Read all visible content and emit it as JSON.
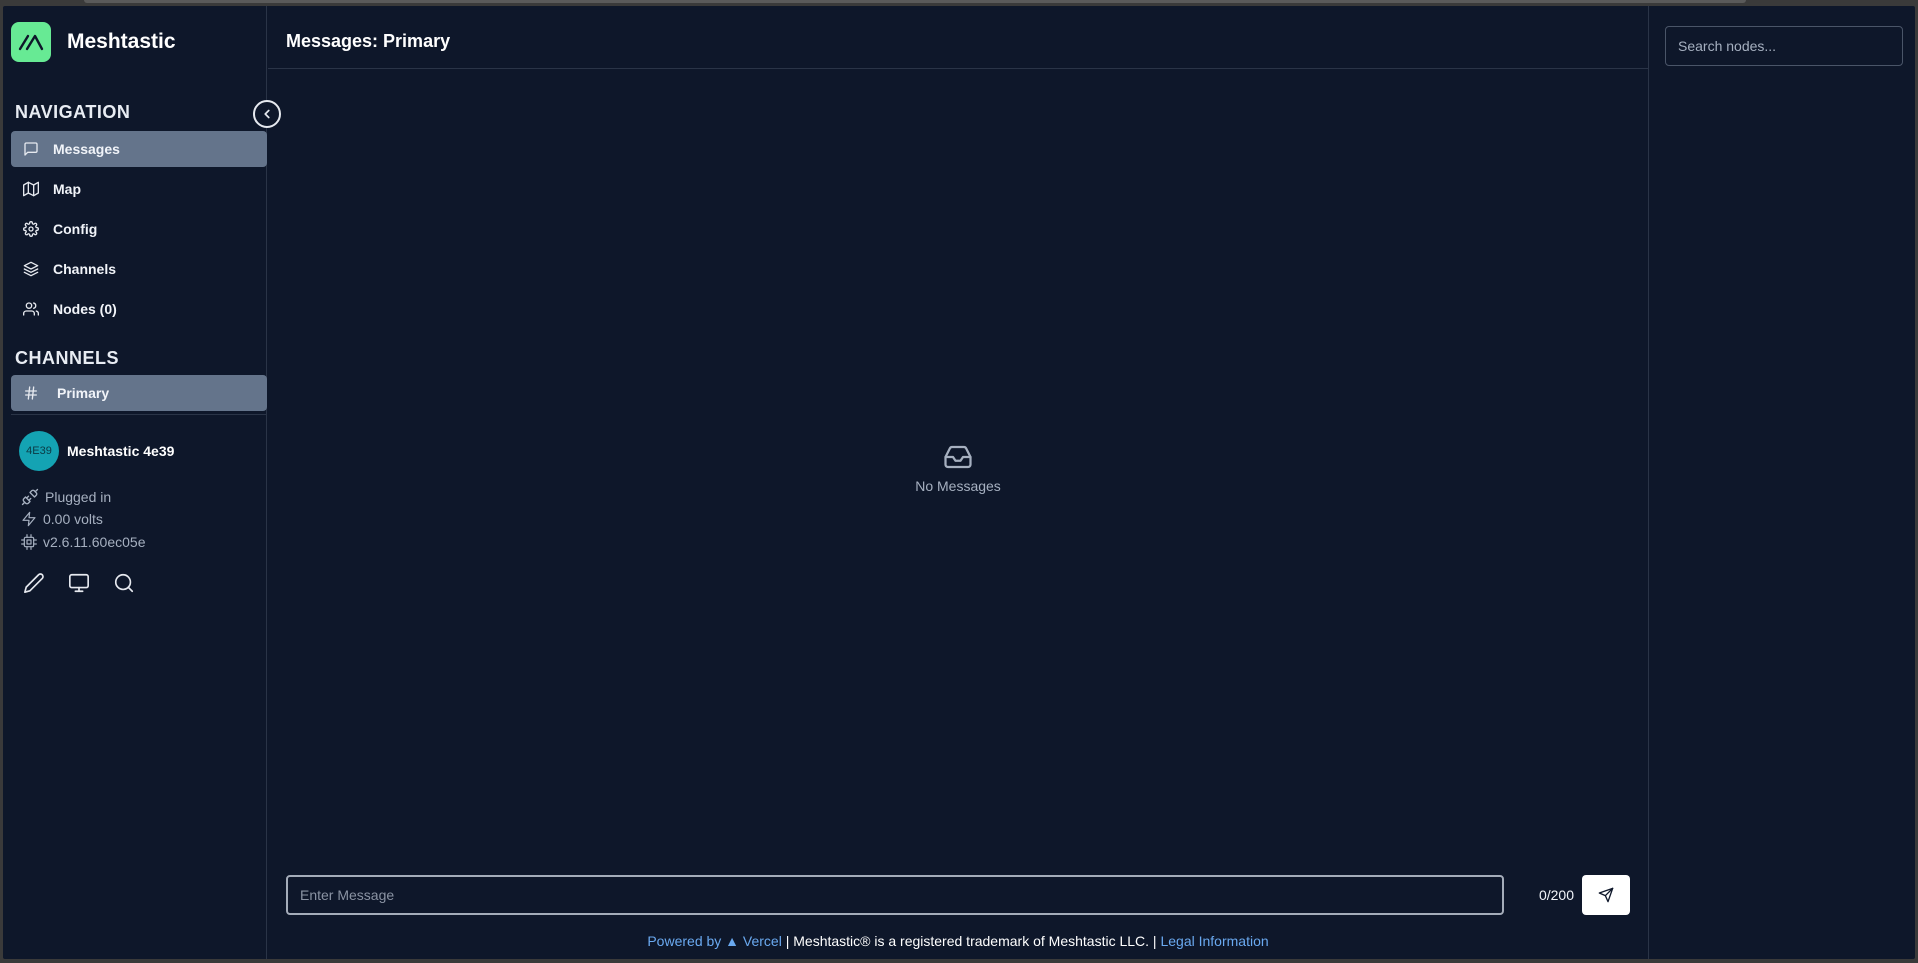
{
  "app": {
    "name": "Meshtastic",
    "accent": "#67ea94",
    "background": "#0e172a",
    "active_item_bg": "#64748b"
  },
  "sidebar": {
    "navigation_title": "NAVIGATION",
    "nav_items": [
      {
        "label": "Messages",
        "icon": "message-square-icon",
        "active": true
      },
      {
        "label": "Map",
        "icon": "map-icon",
        "active": false
      },
      {
        "label": "Config",
        "icon": "gear-icon",
        "active": false
      },
      {
        "label": "Channels",
        "icon": "layers-icon",
        "active": false
      },
      {
        "label": "Nodes (0)",
        "icon": "users-icon",
        "active": false
      }
    ],
    "channels_title": "CHANNELS",
    "channels": [
      {
        "label": "Primary",
        "icon": "hash-icon",
        "active": true
      }
    ],
    "device": {
      "avatar_text": "4E39",
      "name": "Meshtastic 4e39",
      "power": "Plugged in",
      "voltage": "0.00 volts",
      "firmware": "v2.6.11.60ec05e"
    },
    "tools": [
      "pencil-icon",
      "monitor-icon",
      "search-icon"
    ]
  },
  "main": {
    "title": "Messages: Primary",
    "empty_text": "No Messages",
    "composer": {
      "placeholder": "Enter Message",
      "counter": "0/200"
    },
    "footer": {
      "powered": "Powered by ▲ Vercel",
      "sep1": " | ",
      "trademark": "Meshtastic® is a registered trademark of Meshtastic LLC.",
      "sep2": " | ",
      "legal": "Legal Information"
    }
  },
  "right_panel": {
    "search_placeholder": "Search nodes..."
  }
}
